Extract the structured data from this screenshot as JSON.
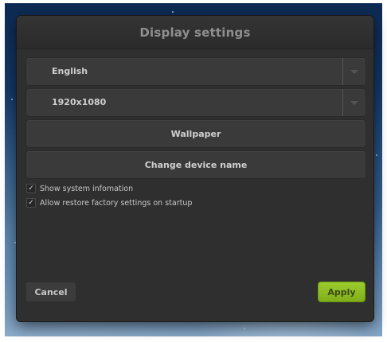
{
  "dialog": {
    "title": "Display settings",
    "language_select": {
      "value": "English"
    },
    "resolution_select": {
      "value": "1920x1080"
    },
    "wallpaper_button": "Wallpaper",
    "change_name_button": "Change device name",
    "checkboxes": [
      {
        "label": "Show system infomation",
        "checked": true
      },
      {
        "label": "Allow restore factory settings on startup",
        "checked": true
      }
    ],
    "cancel_button": "Cancel",
    "apply_button": "Apply",
    "check_glyph": "✓"
  },
  "colors": {
    "dialog_bg": "#2f2f2f",
    "row_bg": "#3a3a3a",
    "apply_green": "#8dbd22",
    "title_text": "#8f8f8f"
  },
  "icons": [
    "chevron-down-icon",
    "check-icon"
  ]
}
